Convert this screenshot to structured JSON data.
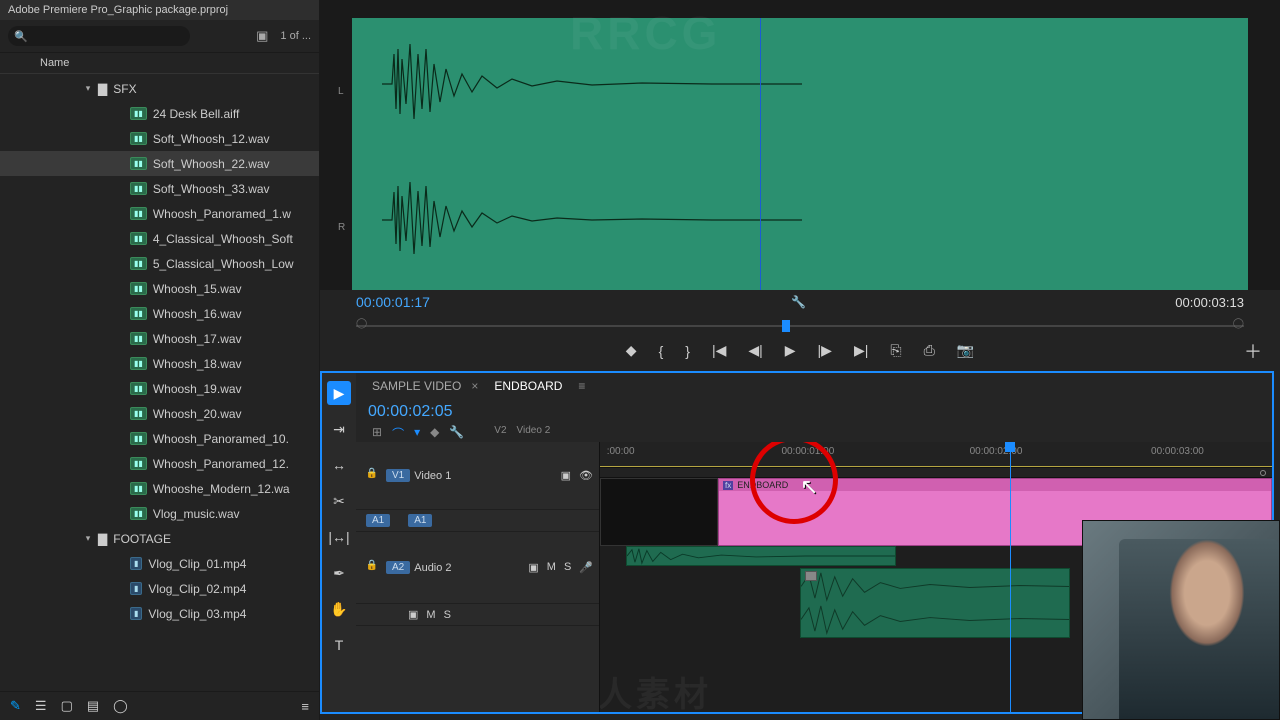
{
  "project": {
    "title": "Adobe Premiere Pro_Graphic package.prproj",
    "search_placeholder": "",
    "selection_count": "1 of ...",
    "name_header": "Name",
    "folders": [
      {
        "name": "SFX",
        "expanded": true,
        "items": [
          {
            "type": "audio",
            "name": "24 Desk Bell.aiff"
          },
          {
            "type": "audio",
            "name": "Soft_Whoosh_12.wav"
          },
          {
            "type": "audio",
            "name": "Soft_Whoosh_22.wav",
            "selected": true
          },
          {
            "type": "audio",
            "name": "Soft_Whoosh_33.wav"
          },
          {
            "type": "audio",
            "name": "Whoosh_Panoramed_1.w"
          },
          {
            "type": "audio",
            "name": "4_Classical_Whoosh_Soft"
          },
          {
            "type": "audio",
            "name": "5_Classical_Whoosh_Low"
          },
          {
            "type": "audio",
            "name": "Whoosh_15.wav"
          },
          {
            "type": "audio",
            "name": "Whoosh_16.wav"
          },
          {
            "type": "audio",
            "name": "Whoosh_17.wav"
          },
          {
            "type": "audio",
            "name": "Whoosh_18.wav"
          },
          {
            "type": "audio",
            "name": "Whoosh_19.wav"
          },
          {
            "type": "audio",
            "name": "Whoosh_20.wav"
          },
          {
            "type": "audio",
            "name": "Whoosh_Panoramed_10."
          },
          {
            "type": "audio",
            "name": "Whoosh_Panoramed_12."
          },
          {
            "type": "audio",
            "name": "Whooshe_Modern_12.wa"
          },
          {
            "type": "audio",
            "name": "Vlog_music.wav"
          }
        ]
      },
      {
        "name": "FOOTAGE",
        "expanded": true,
        "items": [
          {
            "type": "video",
            "name": "Vlog_Clip_01.mp4"
          },
          {
            "type": "video",
            "name": "Vlog_Clip_02.mp4"
          },
          {
            "type": "video",
            "name": "Vlog_Clip_03.mp4"
          }
        ]
      }
    ]
  },
  "source": {
    "channel_left": "L",
    "channel_right": "R",
    "current_tc": "00:00:01:17",
    "duration_tc": "00:00:03:13"
  },
  "timeline": {
    "tabs": [
      {
        "label": "SAMPLE VIDEO",
        "active": false
      },
      {
        "label": "ENDBOARD",
        "active": true
      }
    ],
    "current_tc": "00:00:02:05",
    "ruler": [
      {
        "t": ":00:00",
        "pct": 1
      },
      {
        "t": "00:00:01:00",
        "pct": 27
      },
      {
        "t": "00:00:02:00",
        "pct": 55
      },
      {
        "t": "00:00:03:00",
        "pct": 82
      }
    ],
    "playhead_pct": 61,
    "tracks": {
      "v2_label": "Video 2",
      "v2_badge": "V2",
      "v1_label": "Video 1",
      "v1_badge": "V1",
      "a1_badge": "A1",
      "a2_badge": "A2",
      "a2_label": "Audio 2",
      "mute": "M",
      "solo": "S"
    },
    "clips": {
      "endboard_label": "ENDBOARD",
      "endboard_fx": "fx"
    }
  },
  "watermarks": [
    "RRCG",
    "人人素材"
  ]
}
